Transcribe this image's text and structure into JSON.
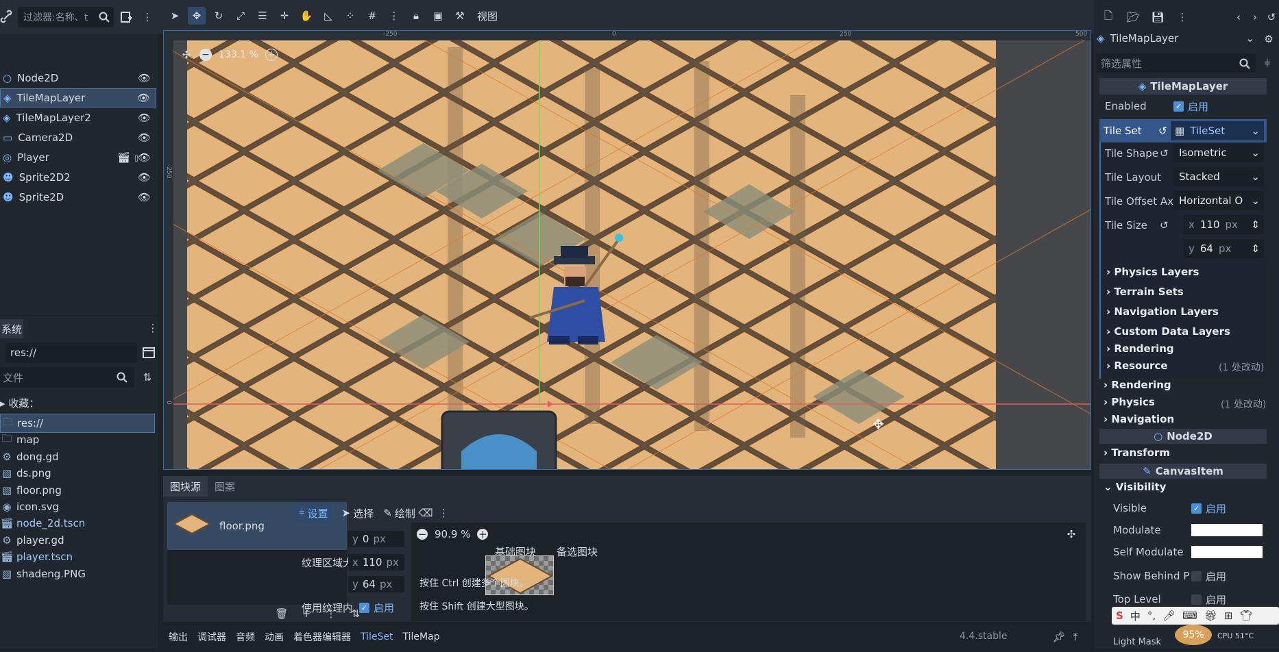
{
  "toolbar": {
    "filter_placeholder": "过滤器:名称、t",
    "view_label": "视图"
  },
  "scene_tree": {
    "nodes": [
      {
        "name": "Node2D",
        "icon": "node2d-icon"
      },
      {
        "name": "TileMapLayer",
        "icon": "tilemap-icon",
        "selected": true
      },
      {
        "name": "TileMapLayer2",
        "icon": "tilemap-icon"
      },
      {
        "name": "Camera2D",
        "icon": "camera-icon"
      },
      {
        "name": "Player",
        "icon": "player-icon"
      },
      {
        "name": "Sprite2D2",
        "icon": "sprite-icon"
      },
      {
        "name": "Sprite2D",
        "icon": "sprite-icon"
      }
    ]
  },
  "filesystem": {
    "tab": "系统",
    "path": "res://",
    "filter_placeholder": "文件",
    "favorites": "收藏：",
    "items": [
      {
        "name": "res://",
        "icon": "folder-icon"
      },
      {
        "name": "map",
        "icon": "folder-icon"
      },
      {
        "name": "dong.gd",
        "icon": "script-gear-icon"
      },
      {
        "name": "ds.png",
        "icon": "image-icon"
      },
      {
        "name": "floor.png",
        "icon": "image-icon"
      },
      {
        "name": "icon.svg",
        "icon": "svg-icon"
      },
      {
        "name": "node_2d.tscn",
        "icon": "scene-icon"
      },
      {
        "name": "player.gd",
        "icon": "script-gear-icon"
      },
      {
        "name": "player.tscn",
        "icon": "scene-icon"
      },
      {
        "name": "shadeng.PNG",
        "icon": "image-icon"
      }
    ]
  },
  "viewport": {
    "zoom": "133.1 %",
    "ruler": [
      "-250",
      "0",
      "250",
      "500",
      "-250",
      "0"
    ]
  },
  "bottom": {
    "tabs": [
      "图块源",
      "图案"
    ],
    "source_item": "floor.png",
    "modes": [
      "设置",
      "选择",
      "绘制"
    ],
    "y0": "0",
    "unit": "px",
    "region_label": "纹理区域大",
    "region_x": "110",
    "region_y": "64",
    "use_texture_label": "使用纹理内",
    "enabled": "启用",
    "atlas_zoom": "90.9 %",
    "base_tiles": "基础图块",
    "alt_tiles": "备选图块",
    "hint1": "按住 Ctrl 创建多个图块。",
    "hint2": "按住 Shift 创建大型图块。"
  },
  "status": {
    "tabs": [
      "输出",
      "调试器",
      "音频",
      "动画",
      "着色器编辑器",
      "TileSet",
      "TileMap"
    ],
    "version": "4.4.stable"
  },
  "inspector": {
    "node_name": "TileMapLayer",
    "filter_placeholder": "筛选属性",
    "class_header": "TileMapLayer",
    "enabled_label": "Enabled",
    "enabled_value": "启用",
    "tileset_label": "Tile Set",
    "tileset_value": "TileSet",
    "tile_shape_label": "Tile Shape",
    "tile_shape": "Isometric",
    "tile_layout_label": "Tile Layout",
    "tile_layout": "Stacked",
    "tile_offset_label": "Tile Offset Axis",
    "tile_offset": "Horizontal O",
    "tile_size_label": "Tile Size",
    "tile_size_x": "110",
    "tile_size_y": "64",
    "unit": "px",
    "sub_sections": [
      "Physics Layers",
      "Terrain Sets",
      "Navigation Layers",
      "Custom Data Layers",
      "Rendering",
      "Resource"
    ],
    "resource_changes": "(1 处改动)",
    "sections": [
      "Rendering",
      "Physics",
      "Navigation"
    ],
    "physics_changes": "(1 处改动)",
    "node2d_header": "Node2D",
    "transform": "Transform",
    "canvas_header": "CanvasItem",
    "visibility": "Visibility",
    "visible_label": "Visible",
    "modulate_label": "Modulate",
    "self_modulate_label": "Self Modulate",
    "show_behind_label": "Show Behind P",
    "top_level_label": "Top Level",
    "light_mask_label": "Light Mask",
    "on": "启用",
    "cpu": "CPU 51°C",
    "percent": "95%"
  }
}
